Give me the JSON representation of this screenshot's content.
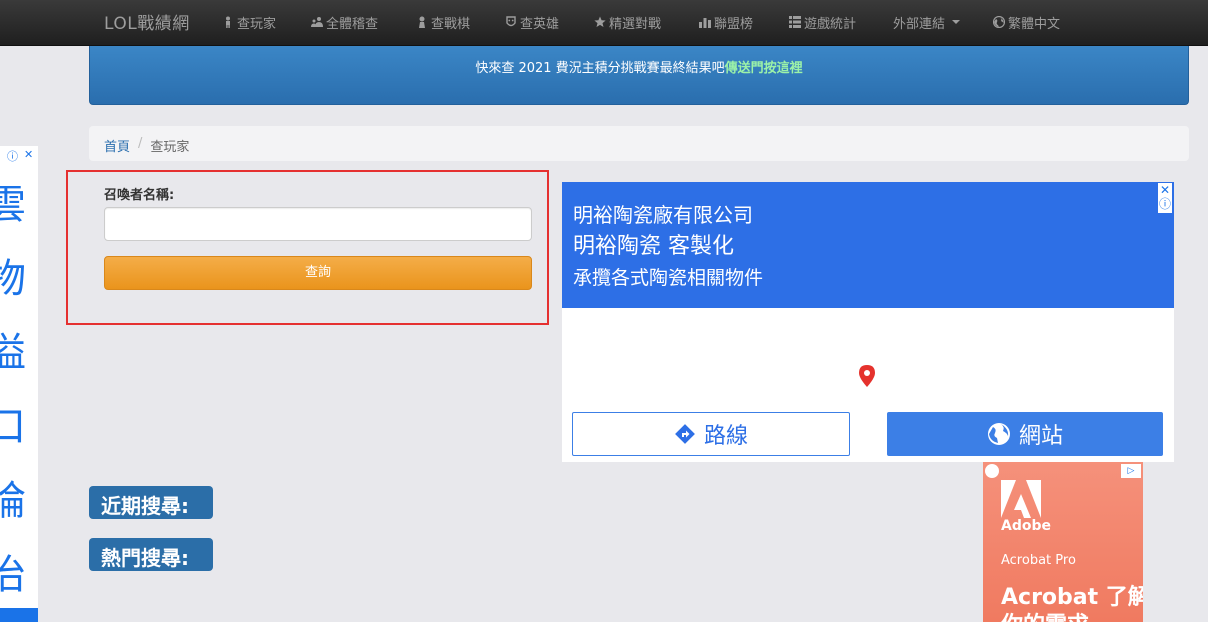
{
  "navbar": {
    "brand": "LOL戰績網",
    "items": [
      {
        "label": "查玩家",
        "icon": "person-icon"
      },
      {
        "label": "全體稽查",
        "icon": "users-icon"
      },
      {
        "label": "查戰棋",
        "icon": "pawn-icon"
      },
      {
        "label": "查英雄",
        "icon": "mask-icon"
      },
      {
        "label": "精選對戰",
        "icon": "star-icon"
      },
      {
        "label": "聯盟榜",
        "icon": "bar-chart-icon"
      },
      {
        "label": "遊戲統計",
        "icon": "list-icon"
      },
      {
        "label": "外部連結",
        "icon": "caret-down-icon"
      },
      {
        "label": "繁體中文",
        "icon": "globe-icon"
      }
    ]
  },
  "banner": {
    "text": "快來查 2021 費況主積分挑戰賽最終結果吧",
    "link": "傳送門按這裡"
  },
  "breadcrumb": {
    "home": "首頁",
    "separator": "/",
    "current": "查玩家"
  },
  "form": {
    "label": "召喚者名稱:",
    "input_value": "",
    "button": "查詢"
  },
  "side_ad": {
    "text": "雲物溢口論治"
  },
  "map_ad": {
    "title": "明裕陶瓷廠有限公司",
    "subtitle": "明裕陶瓷 客製化",
    "description": "承攬各式陶瓷相關物件",
    "route_button": "路線",
    "website_button": "網站"
  },
  "tags": {
    "recent": "近期搜尋:",
    "hot": "熱門搜尋:"
  },
  "adobe_ad": {
    "brand": "Adobe",
    "product": "Acrobat Pro",
    "headline": "Acrobat 了解你的需求"
  },
  "colors": {
    "navbar": "#222222",
    "banner": "#337ab7",
    "button": "#f0a030",
    "highlight": "#e53030",
    "ad_blue": "#2d6fe6"
  }
}
